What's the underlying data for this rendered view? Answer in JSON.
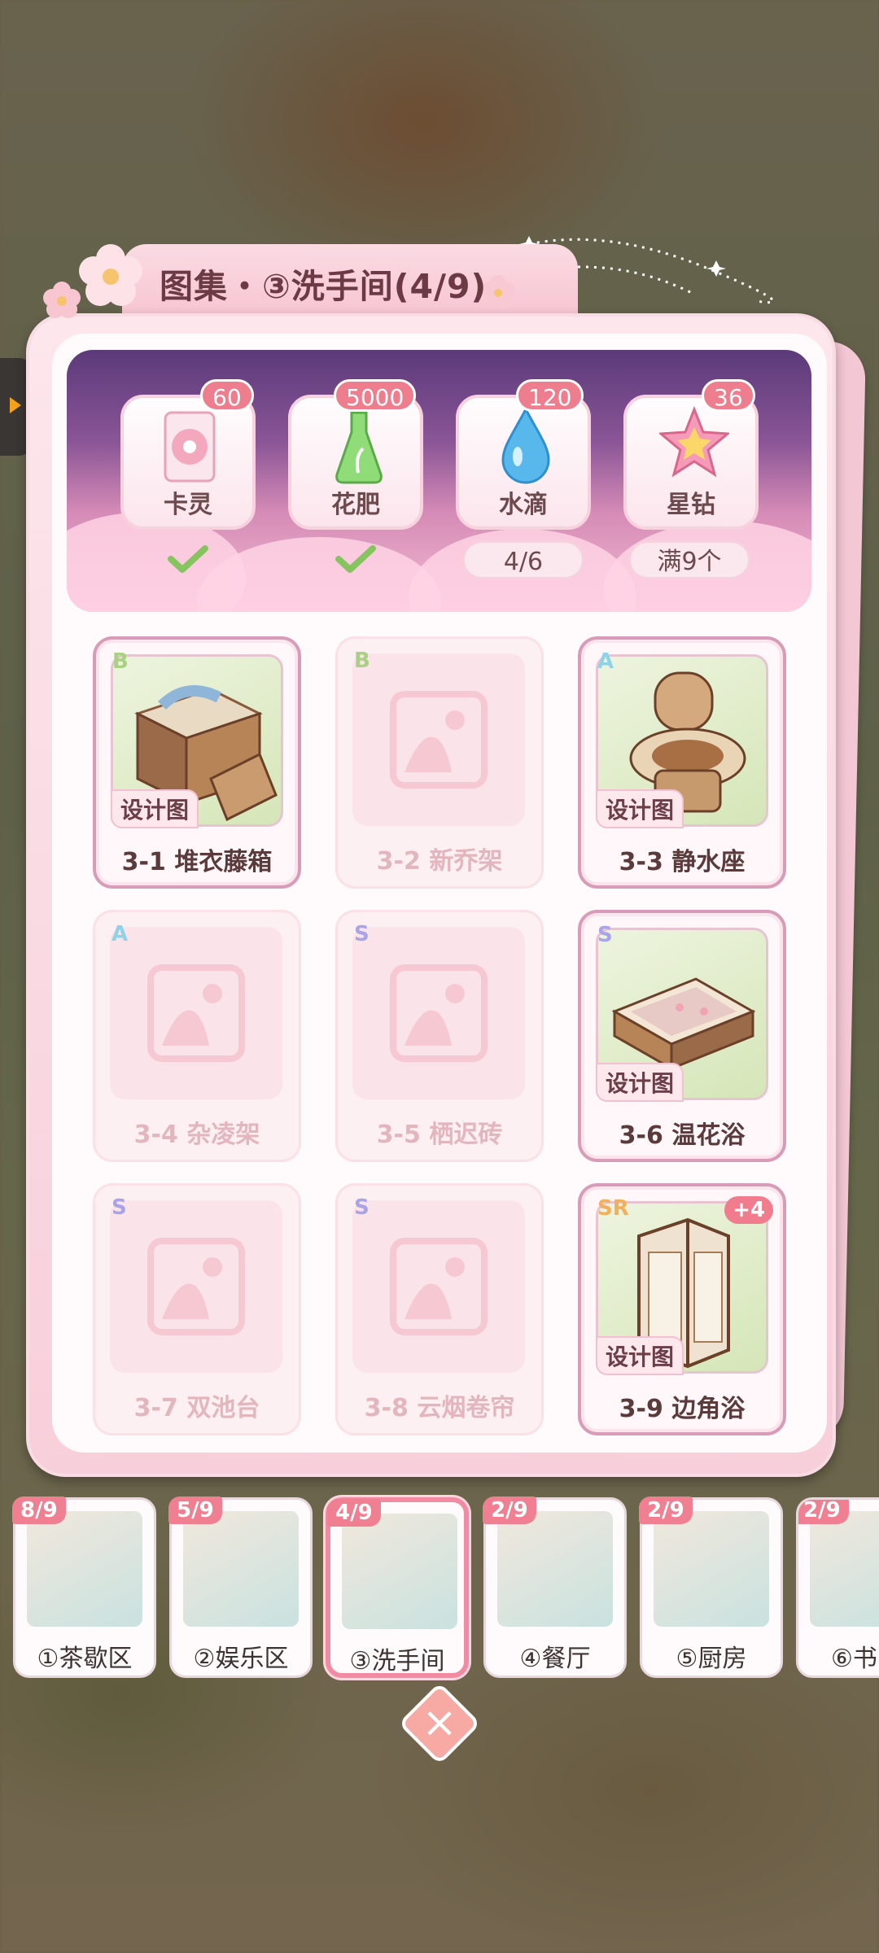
{
  "title": "图集・③洗手间(4/9)",
  "resources": [
    {
      "label": "卡灵",
      "count": "60",
      "status": "check",
      "icon": "card-icon"
    },
    {
      "label": "花肥",
      "count": "5000",
      "status": "check",
      "icon": "fertilizer-flask-icon"
    },
    {
      "label": "水滴",
      "count": "120",
      "status": "4/6",
      "icon": "water-drop-icon"
    },
    {
      "label": "星钻",
      "count": "36",
      "status": "满9个",
      "icon": "star-gem-icon"
    }
  ],
  "items": [
    {
      "rank": "B",
      "name": "3-1 堆衣藤箱",
      "owned": true,
      "tag": "设计图"
    },
    {
      "rank": "B",
      "name": "3-2 新乔架",
      "owned": false
    },
    {
      "rank": "A",
      "name": "3-3 静水座",
      "owned": true,
      "tag": "设计图"
    },
    {
      "rank": "A",
      "name": "3-4 杂凌架",
      "owned": false
    },
    {
      "rank": "S",
      "name": "3-5 栖迟砖",
      "owned": false
    },
    {
      "rank": "S",
      "name": "3-6 温花浴",
      "owned": true,
      "tag": "设计图"
    },
    {
      "rank": "S",
      "name": "3-7 双池台",
      "owned": false
    },
    {
      "rank": "S",
      "name": "3-8 云烟卷帘",
      "owned": false
    },
    {
      "rank": "SR",
      "name": "3-9 边角浴",
      "owned": true,
      "tag": "设计图",
      "extra": "+4"
    }
  ],
  "rooms": [
    {
      "label": "①茶歇区",
      "progress": "8/9"
    },
    {
      "label": "②娱乐区",
      "progress": "5/9"
    },
    {
      "label": "③洗手间",
      "progress": "4/9",
      "active": true
    },
    {
      "label": "④餐厅",
      "progress": "2/9"
    },
    {
      "label": "⑤厨房",
      "progress": "2/9"
    },
    {
      "label": "⑥书",
      "progress": "2/9"
    }
  ],
  "close_label": "×",
  "colors": {
    "accent": "#f07c8e",
    "rank_B": "#a8d184",
    "rank_A": "#8fd3e8",
    "rank_S": "#a9a3e8",
    "rank_SR": "#f2b05a"
  }
}
